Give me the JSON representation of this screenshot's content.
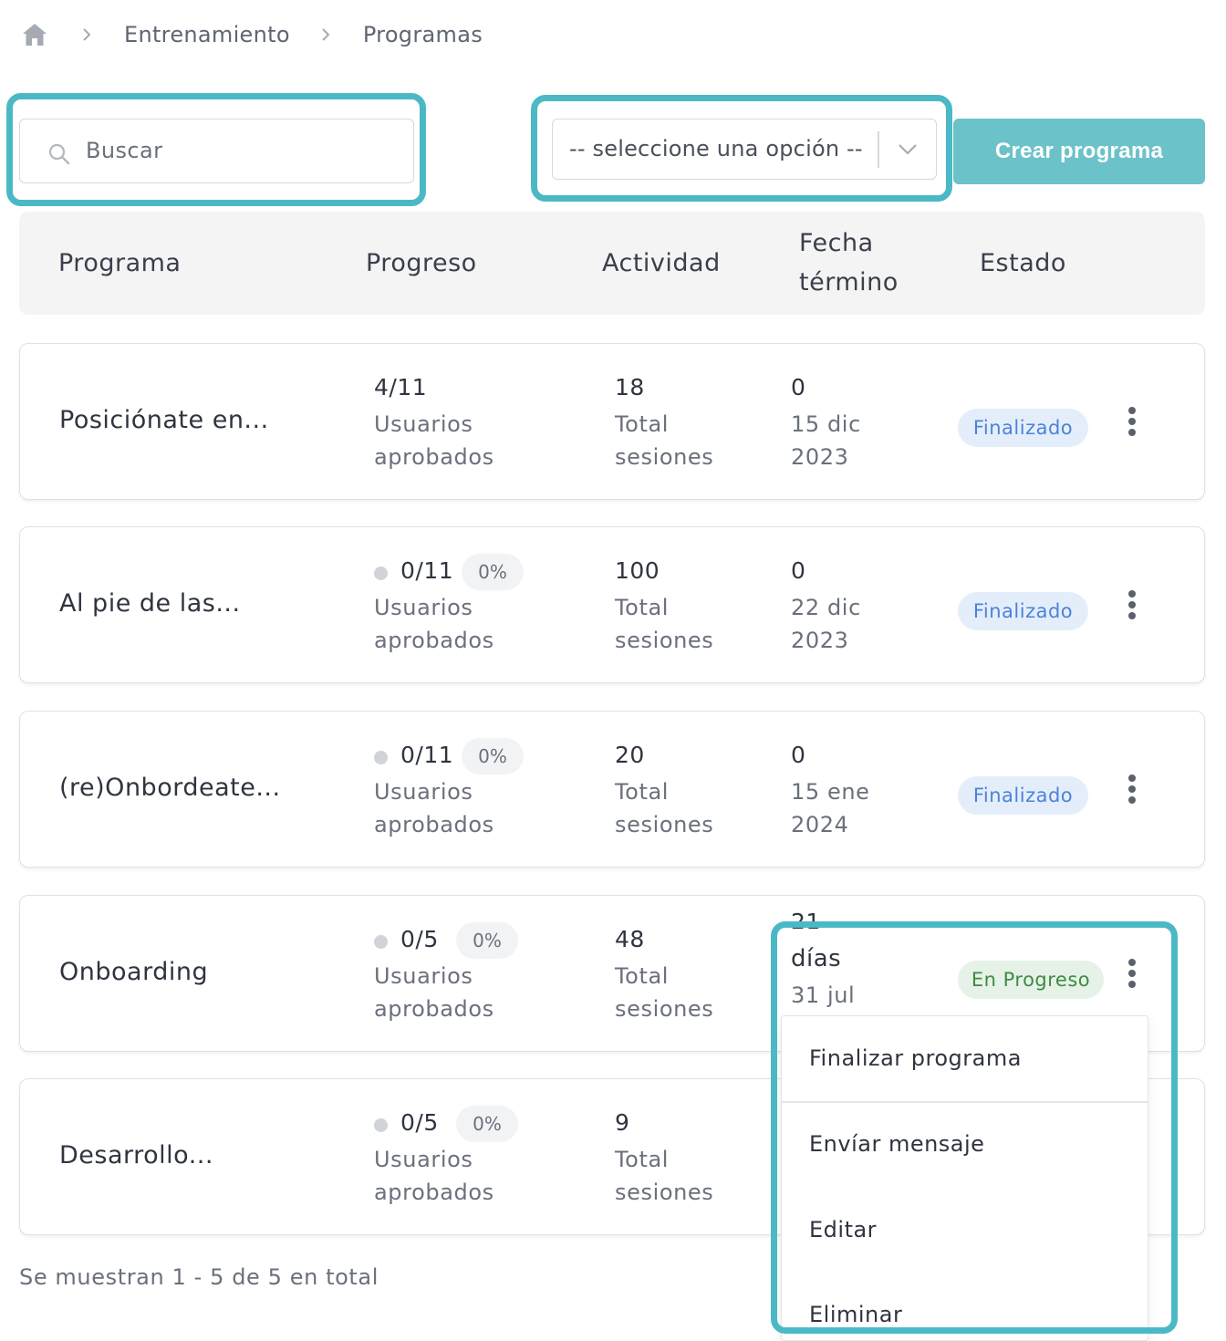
{
  "breadcrumb": {
    "home_icon": "home-icon",
    "items": [
      "Entrenamiento",
      "Programas"
    ]
  },
  "search": {
    "placeholder": "Buscar"
  },
  "filter": {
    "selected": "-- seleccione una opción --"
  },
  "create_button": "Crear programa",
  "table": {
    "headers": {
      "programa": "Programa",
      "progreso": "Progreso",
      "actividad": "Actividad",
      "fecha_1": "Fecha",
      "fecha_2": "término",
      "estado": "Estado"
    },
    "rows": [
      {
        "name": "Posiciónate en...",
        "progress": "4/11",
        "progress_pct": "",
        "progress_l1": "Usuarios",
        "progress_l2": "aprobados",
        "activity": "18",
        "activity_l1": "Total",
        "activity_l2": "sesiones",
        "date_top": "0",
        "date_l1": "15 dic",
        "date_l2": "2023",
        "status": "Finalizado"
      },
      {
        "name": "Al pie de las...",
        "progress": "0/11",
        "progress_pct": "0%",
        "progress_l1": "Usuarios",
        "progress_l2": "aprobados",
        "activity": "100",
        "activity_l1": "Total",
        "activity_l2": "sesiones",
        "date_top": "0",
        "date_l1": "22 dic",
        "date_l2": "2023",
        "status": "Finalizado"
      },
      {
        "name": "(re)Onbordeate...",
        "progress": "0/11",
        "progress_pct": "0%",
        "progress_l1": "Usuarios",
        "progress_l2": "aprobados",
        "activity": "20",
        "activity_l1": "Total",
        "activity_l2": "sesiones",
        "date_top": "0",
        "date_l1": "15 ene",
        "date_l2": "2024",
        "status": "Finalizado"
      },
      {
        "name": "Onboarding",
        "progress": "0/5",
        "progress_pct": "0%",
        "progress_l1": "Usuarios",
        "progress_l2": "aprobados",
        "activity": "48",
        "activity_l1": "Total",
        "activity_l2": "sesiones",
        "date_top": "21",
        "date_l1": "días",
        "date_l2": "31 jul",
        "status": "En Progreso"
      },
      {
        "name": "Desarrollo...",
        "progress": "0/5",
        "progress_pct": "0%",
        "progress_l1": "Usuarios",
        "progress_l2": "aprobados",
        "activity": "9",
        "activity_l1": "Total",
        "activity_l2": "sesiones"
      }
    ]
  },
  "menu": {
    "items": [
      "Finalizar programa",
      "Envíar mensaje",
      "Editar",
      "Eliminar"
    ]
  },
  "footer": "Se muestran 1 - 5 de 5 en total",
  "colors": {
    "accent": "#6cc2c9",
    "highlight": "#4bb9c5",
    "status_done_bg": "#e4eefb",
    "status_done_text": "#4c83d8",
    "status_progress_bg": "#e6f2e7",
    "status_progress_text": "#3f8a43"
  }
}
